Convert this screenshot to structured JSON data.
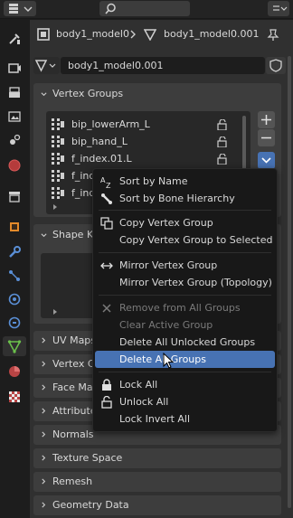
{
  "header": {
    "breadcrumb_object": "body1_model0",
    "breadcrumb_mesh": "body1_model0.001",
    "mesh_datablock": "body1_model0.001"
  },
  "vertex_groups": {
    "title": "Vertex Groups",
    "items": [
      "bip_lowerArm_L",
      "bip_hand_L",
      "f_index.01.L",
      "f_inde",
      "f_inde"
    ]
  },
  "panels": {
    "shape_keys": "Shape Ke",
    "uv_maps": "UV Maps",
    "vertex_colors": "Vertex C",
    "face_maps": "Face Map",
    "attributes": "Attribute",
    "normals": "Normals",
    "texture_space": "Texture Space",
    "remesh": "Remesh",
    "geometry_data": "Geometry Data"
  },
  "context_menu": {
    "sort_by_name": "Sort by Name",
    "sort_by_bone": "Sort by Bone Hierarchy",
    "copy_group": "Copy Vertex Group",
    "copy_to_selected": "Copy Vertex Group to Selected",
    "mirror": "Mirror Vertex Group",
    "mirror_topology": "Mirror Vertex Group (Topology)",
    "remove_from_all": "Remove from All Groups",
    "clear_active": "Clear Active Group",
    "delete_unlocked": "Delete All Unlocked Groups",
    "delete_all": "Delete All Groups",
    "lock_all": "Lock All",
    "unlock_all": "Unlock All",
    "lock_invert_all": "Lock Invert All"
  },
  "colors": {
    "accent": "#4772b3",
    "active_tab_icon": "#6bc04b"
  }
}
